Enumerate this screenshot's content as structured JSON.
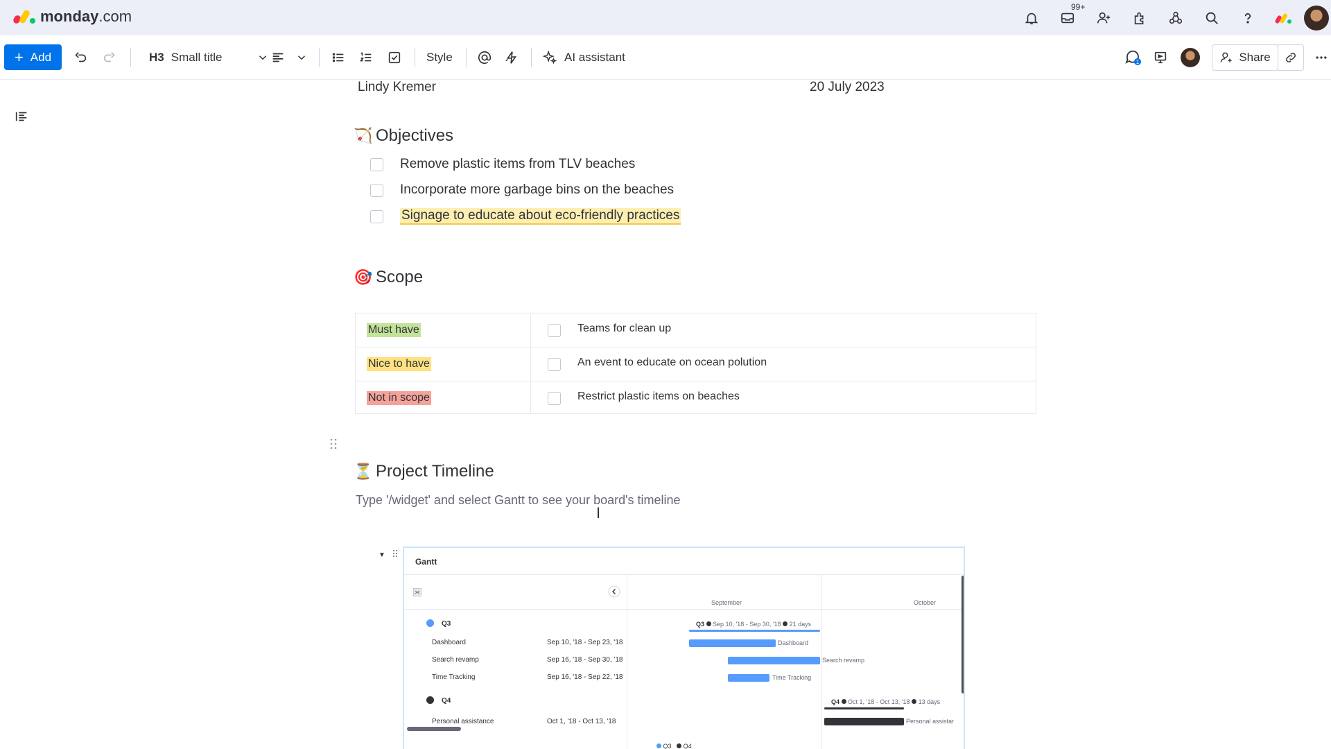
{
  "app": {
    "logo_brand": "monday",
    "logo_suffix": ".com",
    "brand_colors": [
      "#f62b54",
      "#ffcb00",
      "#00ca72"
    ],
    "notifications_badge": "99+"
  },
  "toolbar": {
    "add_label": "Add",
    "text_style": "Small title",
    "text_style_prefix": "H3",
    "style_label": "Style",
    "ai_label": "AI assistant",
    "share_label": "Share",
    "updates_badge": "1",
    "accent": "#0073ea"
  },
  "doc": {
    "author": "Lindy Kremer",
    "date": "20 July 2023",
    "objectives": {
      "title": "Objectives",
      "icon": "bow-and-arrow-icon",
      "items": [
        {
          "text": "Remove plastic items from TLV beaches",
          "checked": false
        },
        {
          "text": "Incorporate more garbage bins on the beaches",
          "checked": false
        },
        {
          "text": "Signage to educate about eco-friendly practices",
          "checked": false,
          "highlight": "#fdefb2"
        }
      ]
    },
    "scope": {
      "title": "Scope",
      "icon": "target-icon",
      "rows": [
        {
          "tag": "Must have",
          "tag_color": "#c3e29a",
          "item": "Teams for clean up"
        },
        {
          "tag": "Nice to have",
          "tag_color": "#ffe180",
          "item": "An event to educate on ocean polution"
        },
        {
          "tag": "Not in scope",
          "tag_color": "#f4a29a",
          "item": "Restrict plastic items on beaches"
        }
      ]
    },
    "timeline": {
      "title": "Project Timeline",
      "icon": "hourglass-icon",
      "placeholder": "Type '/widget' and select Gantt to see your board's timeline"
    }
  },
  "gantt": {
    "title": "Gantt",
    "months": [
      "September",
      "October"
    ],
    "groups": [
      {
        "name": "Q3",
        "color": "#579bfc",
        "summary": "Sep 10, '18 - Sep 30, '18",
        "duration": "21 days",
        "items": [
          {
            "name": "Dashboard",
            "dates": "Sep 10, '18 - Sep 23, '18"
          },
          {
            "name": "Search revamp",
            "dates": "Sep 16, '18 - Sep 30, '18"
          },
          {
            "name": "Time Tracking",
            "dates": "Sep 16, '18 - Sep 22, '18"
          }
        ]
      },
      {
        "name": "Q4",
        "color": "#323338",
        "summary": "Oct 1, '18 - Oct 13, '18",
        "duration": "13 days",
        "items": [
          {
            "name": "Personal assistance",
            "dates": "Oct 1, '18 - Oct 13, '18",
            "bar_label": "Personal assistar"
          }
        ]
      }
    ],
    "legend": [
      "Q3",
      "Q4"
    ]
  }
}
